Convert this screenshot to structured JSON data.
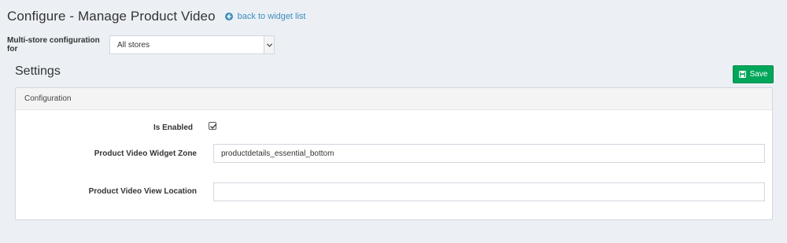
{
  "header": {
    "title": "Configure - Manage Product Video",
    "back_link_label": "back to widget list"
  },
  "store_scope": {
    "label": "Multi-store configuration for",
    "selected": "All stores"
  },
  "settings": {
    "title": "Settings",
    "save_label": "Save"
  },
  "panel": {
    "title": "Configuration",
    "fields": {
      "is_enabled": {
        "label": "Is Enabled",
        "checked": true
      },
      "widget_zone": {
        "label": "Product Video Widget Zone",
        "value": "productdetails_essential_bottom"
      },
      "view_location": {
        "label": "Product Video View Location",
        "value": ""
      }
    }
  },
  "icons": {
    "back": "arrow-circle-left-icon",
    "save": "floppy-disk-icon",
    "dropdown": "chevron-down-icon",
    "checkbox": "check-icon"
  },
  "colors": {
    "background": "#ecf0f5",
    "link": "#3c8dbc",
    "save_button": "#00a65a"
  }
}
